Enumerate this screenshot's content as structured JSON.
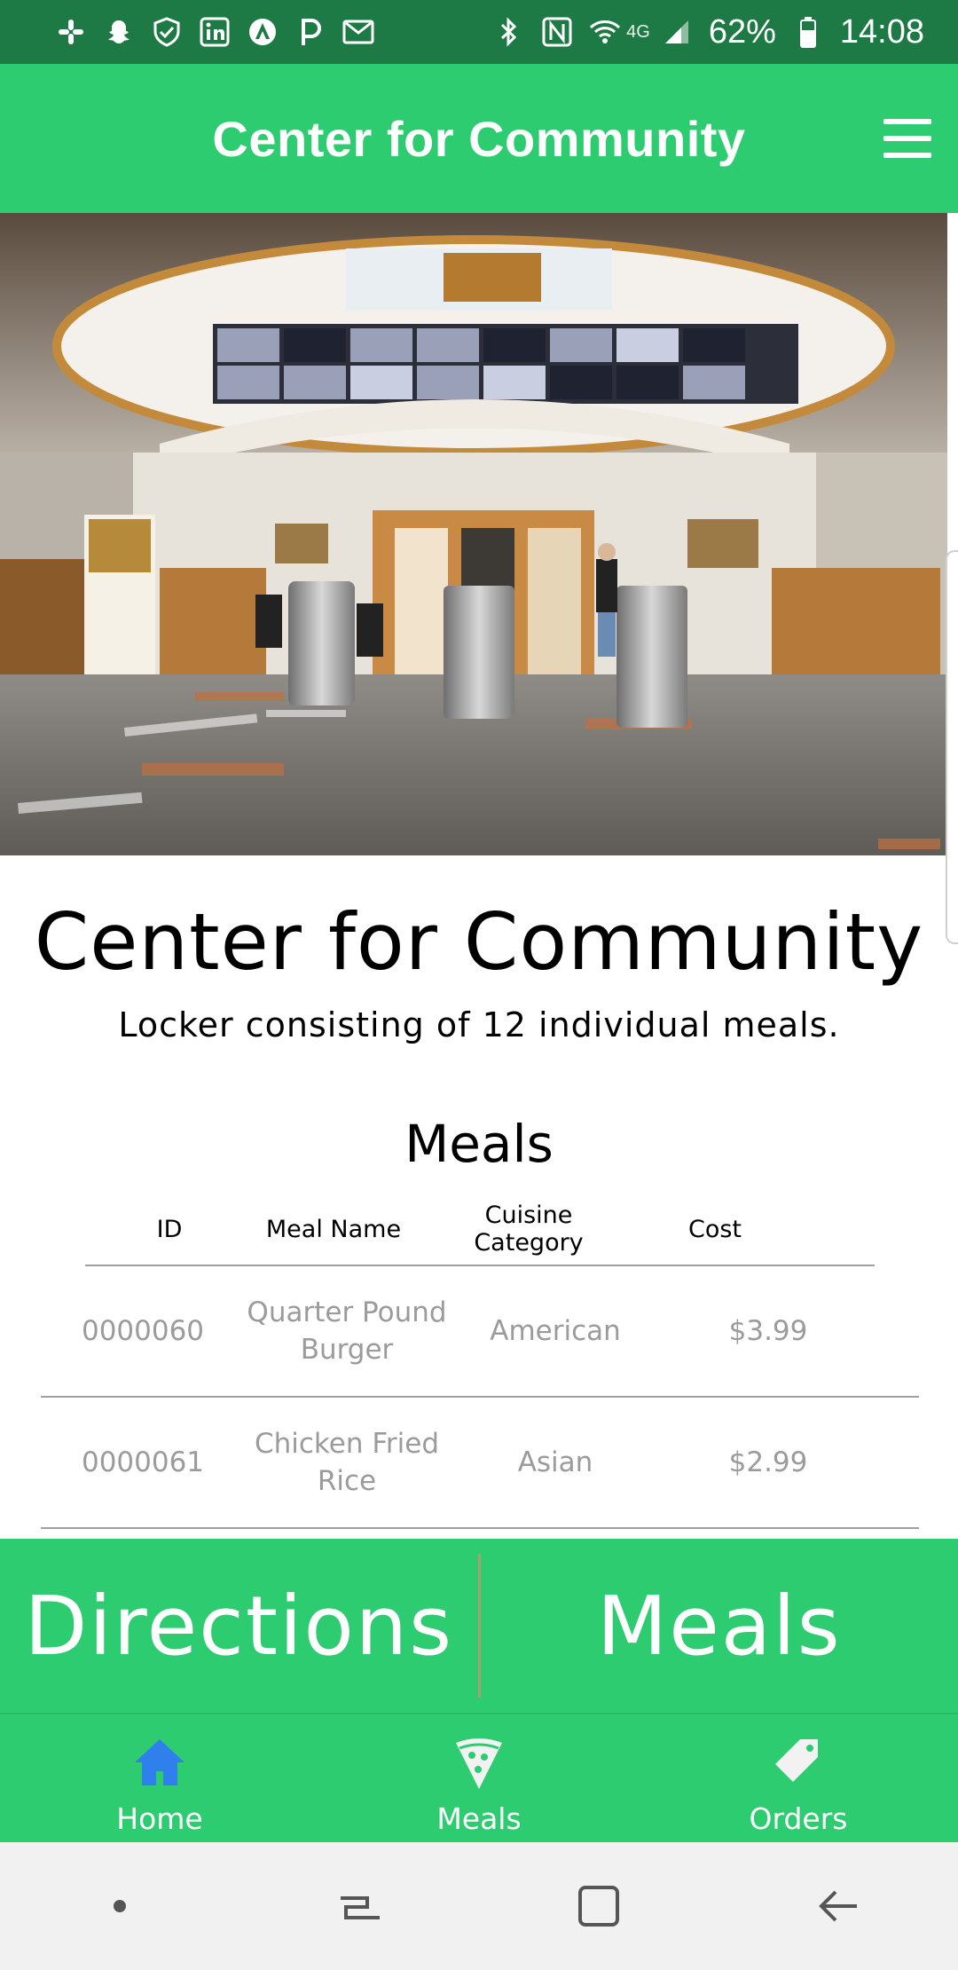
{
  "status_bar": {
    "left_icons": [
      "slack-icon",
      "snapchat-icon",
      "shield-icon",
      "linkedin-icon",
      "arch-icon",
      "p-icon",
      "mail-icon"
    ],
    "right_icons": [
      "bluetooth-icon",
      "nfc-icon",
      "wifi-icon",
      "signal-icon",
      "battery-icon"
    ],
    "network": "4G",
    "battery": "62%",
    "time": "14:08"
  },
  "app_bar": {
    "title": "Center for Community"
  },
  "hero": {
    "alt": "Center for Community dining hall entrance"
  },
  "location": {
    "name": "Center for Community",
    "description": "Locker consisting of 12 individual meals."
  },
  "meals_section": {
    "heading": "Meals",
    "columns": [
      "ID",
      "Meal Name",
      "Cuisine Category",
      "Cost"
    ],
    "rows": [
      {
        "id": "0000060",
        "name": "Quarter Pound Burger",
        "category": "American",
        "cost": "$3.99"
      },
      {
        "id": "0000061",
        "name": "Chicken Fried Rice",
        "category": "Asian",
        "cost": "$2.99"
      }
    ]
  },
  "actions": {
    "directions_label": "Directions",
    "meals_label": "Meals"
  },
  "bottom_nav": {
    "items": [
      {
        "label": "Home",
        "icon": "home-icon",
        "active": true
      },
      {
        "label": "Meals",
        "icon": "pizza-icon",
        "active": false
      },
      {
        "label": "Orders",
        "icon": "tag-icon",
        "active": false
      }
    ]
  },
  "colors": {
    "primary": "#2ecc71",
    "status_bar": "#1e7a44",
    "active_icon": "#2f80ed",
    "muted_text": "#9b9b9b"
  }
}
